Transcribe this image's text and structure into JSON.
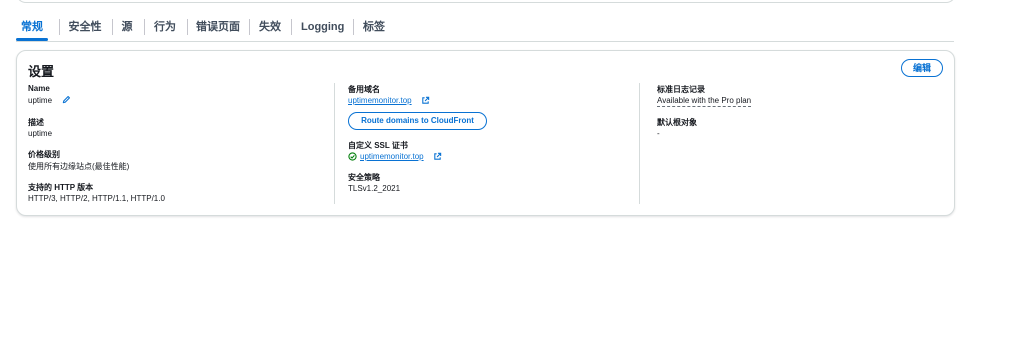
{
  "tabs": [
    {
      "label": "常规",
      "active": true
    },
    {
      "label": "安全性"
    },
    {
      "label": "源"
    },
    {
      "label": "行为"
    },
    {
      "label": "错误页面"
    },
    {
      "label": "失效"
    },
    {
      "label": "Logging"
    },
    {
      "label": "标签"
    }
  ],
  "settings": {
    "title": "设置",
    "edit_label": "编辑",
    "name_label": "Name",
    "name_value": "uptime",
    "description_label": "描述",
    "description_value": "uptime",
    "price_class_label": "价格级别",
    "price_class_value": "使用所有边缘站点(最佳性能)",
    "http_versions_label": "支持的 HTTP 版本",
    "http_versions_value": "HTTP/3, HTTP/2, HTTP/1.1, HTTP/1.0",
    "alt_domain_label": "备用域名",
    "alt_domain_value": "uptimemonitor.top",
    "route_button_label": "Route domains to CloudFront",
    "ssl_label": "自定义 SSL 证书",
    "ssl_value": "uptimemonitor.top",
    "security_policy_label": "安全策略",
    "security_policy_value": "TLSv1.2_2021",
    "std_logging_label": "标准日志记录",
    "std_logging_value": "Available with the Pro plan",
    "default_root_label": "默认根对象",
    "default_root_value": "-"
  },
  "colors": {
    "accent": "#0972d3",
    "success": "#037f0c",
    "border": "#d5dbdb"
  },
  "icons": [
    "edit-pencil-icon",
    "external-link-icon",
    "success-check-icon"
  ]
}
